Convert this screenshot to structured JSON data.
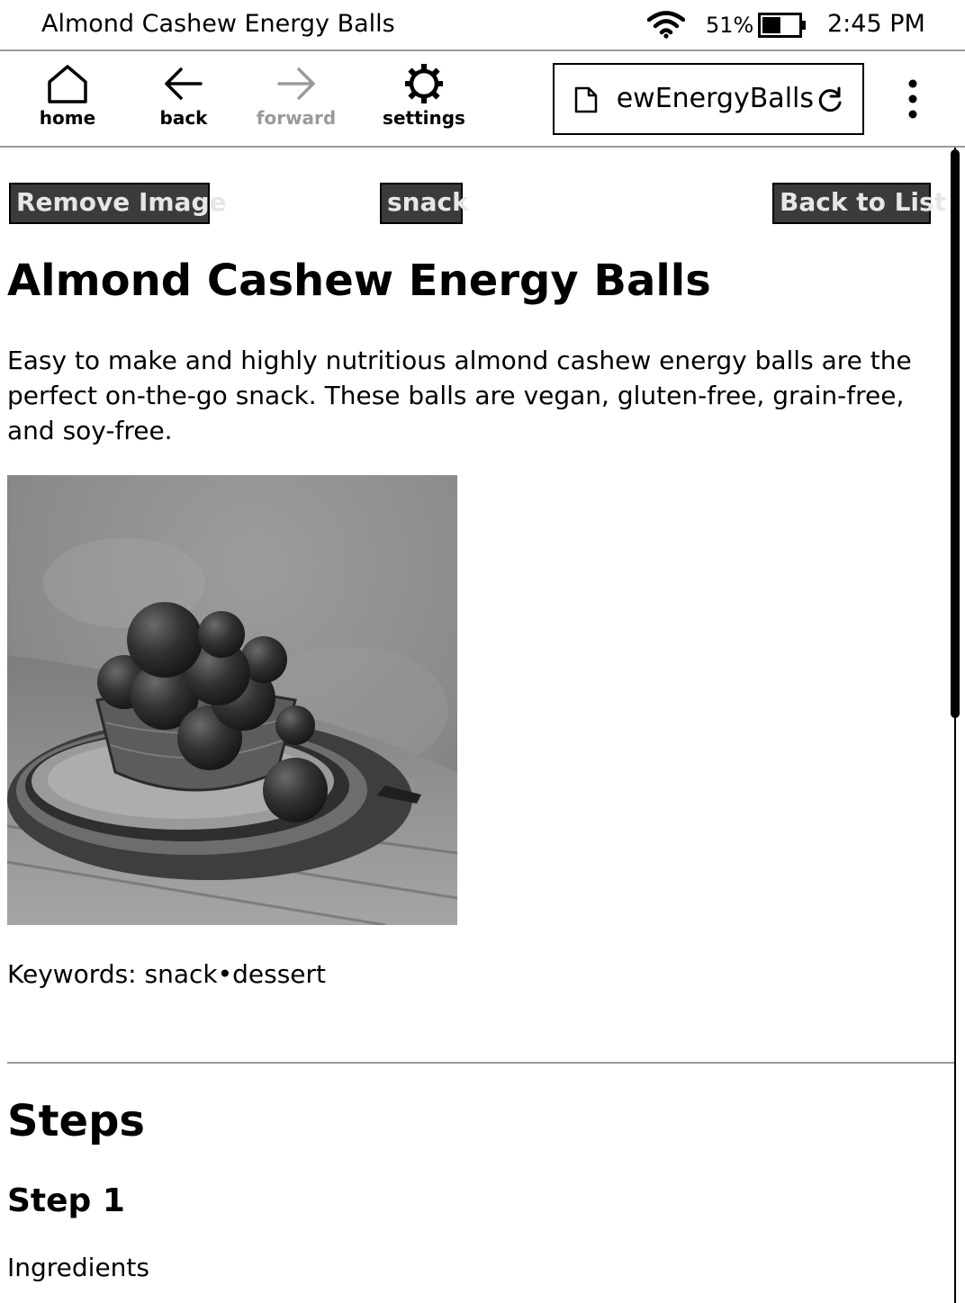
{
  "status_bar": {
    "title": "Almond Cashew Energy Balls",
    "wifi_icon": "wifi-icon",
    "battery_percent": "51%",
    "battery_level": 0.51,
    "time": "2:45 PM"
  },
  "toolbar": {
    "home_label": "home",
    "back_label": "back",
    "forward_label": "forward",
    "forward_enabled": false,
    "settings_label": "settings",
    "url_text": "AlmondCashewEnergyBalls",
    "icons": [
      "home-icon",
      "back-arrow-icon",
      "forward-arrow-icon",
      "gear-icon",
      "document-icon",
      "reload-icon",
      "more-vertical-icon"
    ]
  },
  "page": {
    "remove_image_label": "Remove Image",
    "tag_label": "snack",
    "back_to_list_label": "Back to List",
    "title": "Almond Cashew Energy Balls",
    "description": "Easy to make and highly nutritious almond cashew energy balls are the perfect on-the-go snack. These balls are vegan, gluten-free, grain-free, and soy-free.",
    "keywords": "Keywords: snack•dessert",
    "steps_heading": "Steps",
    "step_1_heading": "Step 1",
    "ingredients_label": "Ingredients"
  },
  "colors": {
    "button_bg": "#3b3b3b",
    "button_text": "#e6e6e6",
    "disabled_text": "#9a9a9a",
    "divider": "#9a9a9a"
  }
}
